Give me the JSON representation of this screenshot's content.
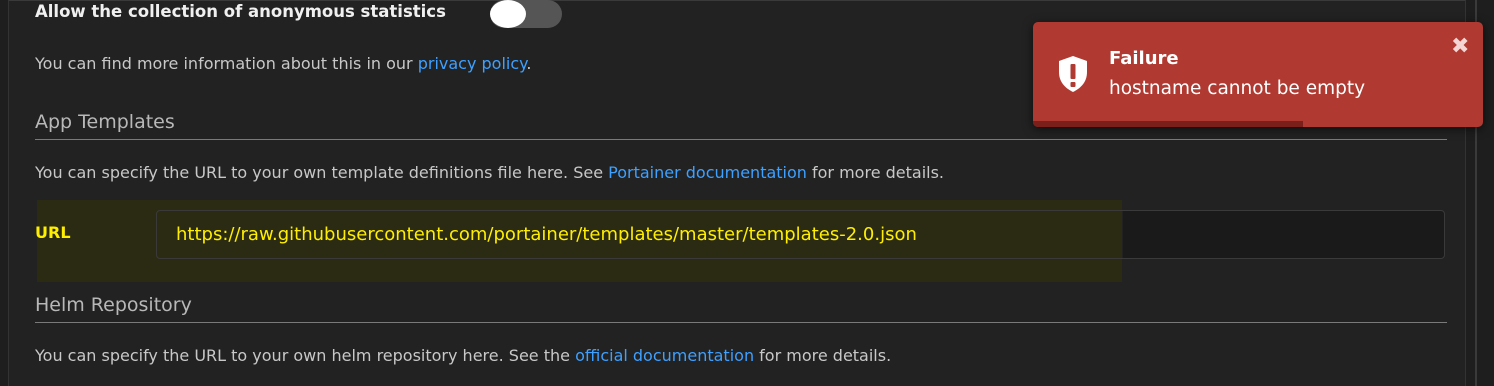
{
  "anonymous_stats": {
    "label": "Allow the collection of anonymous statistics",
    "toggle_enabled": false
  },
  "privacy": {
    "text": "You can find more information about this in our ",
    "link": "privacy policy",
    "suffix": "."
  },
  "app_templates": {
    "title": "App Templates",
    "description_prefix": "You can specify the URL to your own template definitions file here. See ",
    "description_link": "Portainer documentation",
    "description_suffix": " for more details.",
    "url_label": "URL",
    "url_value": "https://raw.githubusercontent.com/portainer/templates/master/templates-2.0.json"
  },
  "helm": {
    "title": "Helm Repository",
    "description_prefix": "You can specify the URL to your own helm repository here. See the ",
    "description_link": "official documentation",
    "description_suffix": " for more details."
  },
  "toast": {
    "title": "Failure",
    "message": "hostname cannot be empty",
    "close_glyph": "✖",
    "icon": "shield-exclamation-icon",
    "progress": 0.6,
    "color": "#b03a32"
  },
  "colors": {
    "link": "#3ea0ff",
    "highlight_text": "#ffee00",
    "background": "#222222"
  }
}
